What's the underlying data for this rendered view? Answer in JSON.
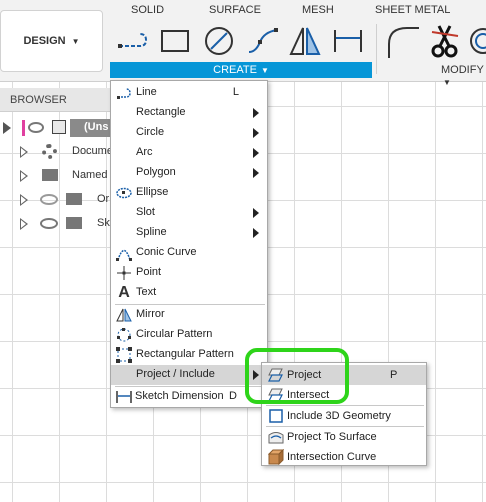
{
  "toolbar": {
    "workspace": "DESIGN",
    "tabs": [
      "SOLID",
      "SURFACE",
      "MESH",
      "SHEET METAL"
    ],
    "create_label": "CREATE",
    "modify_label": "MODIFY"
  },
  "browser": {
    "title": "BROWSER",
    "root_label": "(Uns",
    "rows": [
      "Docume",
      "Named",
      "Or",
      "Sk"
    ]
  },
  "create_menu": {
    "items": [
      {
        "label": "Line",
        "shortcut": "L",
        "submenu": false,
        "icon": "line-icon"
      },
      {
        "label": "Rectangle",
        "shortcut": "",
        "submenu": true,
        "icon": ""
      },
      {
        "label": "Circle",
        "shortcut": "",
        "submenu": true,
        "icon": ""
      },
      {
        "label": "Arc",
        "shortcut": "",
        "submenu": true,
        "icon": ""
      },
      {
        "label": "Polygon",
        "shortcut": "",
        "submenu": true,
        "icon": ""
      },
      {
        "label": "Ellipse",
        "shortcut": "",
        "submenu": false,
        "icon": "ellipse-icon"
      },
      {
        "label": "Slot",
        "shortcut": "",
        "submenu": true,
        "icon": ""
      },
      {
        "label": "Spline",
        "shortcut": "",
        "submenu": true,
        "icon": ""
      },
      {
        "label": "Conic Curve",
        "shortcut": "",
        "submenu": false,
        "icon": "conic-curve-icon"
      },
      {
        "label": "Point",
        "shortcut": "",
        "submenu": false,
        "icon": "point-icon"
      },
      {
        "label": "Text",
        "shortcut": "",
        "submenu": false,
        "icon": "text-icon"
      },
      {
        "label": "Mirror",
        "shortcut": "",
        "submenu": false,
        "icon": "mirror-icon"
      },
      {
        "label": "Circular Pattern",
        "shortcut": "",
        "submenu": false,
        "icon": "circular-pattern-icon"
      },
      {
        "label": "Rectangular Pattern",
        "shortcut": "",
        "submenu": false,
        "icon": "rectangular-pattern-icon"
      },
      {
        "label": "Project / Include",
        "shortcut": "",
        "submenu": true,
        "icon": ""
      },
      {
        "label": "Sketch Dimension",
        "shortcut": "D",
        "submenu": false,
        "icon": "sketch-dimension-icon"
      }
    ]
  },
  "project_submenu": {
    "items": [
      {
        "label": "Project",
        "shortcut": "P",
        "icon": "project-icon"
      },
      {
        "label": "Intersect",
        "shortcut": "",
        "icon": "intersect-icon"
      },
      {
        "label": "Include 3D Geometry",
        "shortcut": "",
        "icon": "include-3d-geometry-icon"
      },
      {
        "label": "Project To Surface",
        "shortcut": "",
        "icon": "project-to-surface-icon"
      },
      {
        "label": "Intersection Curve",
        "shortcut": "",
        "icon": "intersection-curve-icon"
      }
    ]
  },
  "colors": {
    "accent": "#0696d7",
    "highlight_annotation": "#2ed41a",
    "menu_highlight": "#d6d6d6"
  }
}
